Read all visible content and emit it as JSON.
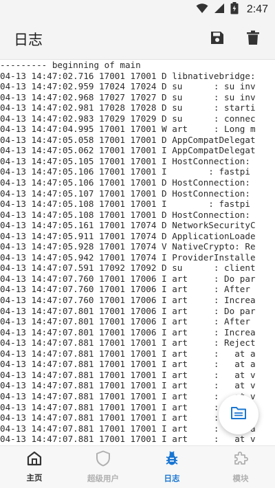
{
  "status_bar": {
    "time": "2:47",
    "icons": [
      "wifi-icon",
      "signal-icon",
      "battery-icon"
    ]
  },
  "app_bar": {
    "title": "日志",
    "actions": [
      "save-icon",
      "delete-icon"
    ]
  },
  "log": {
    "lines": [
      "--------- beginning of main",
      "04-13 14:47:02.716 17001 17001 D libnativebridge:",
      "04-13 14:47:02.959 17024 17024 D su      : su inv",
      "04-13 14:47:02.968 17027 17027 D su      : su inv",
      "04-13 14:47:02.981 17028 17028 D su      : starti",
      "04-13 14:47:02.983 17029 17029 D su      : connec",
      "04-13 14:47:04.995 17001 17001 W art     : Long m",
      "04-13 14:47:05.058 17001 17001 D AppCompatDelegat",
      "04-13 14:47:05.062 17001 17001 I AppCompatDelegat",
      "04-13 14:47:05.105 17001 17001 I HostConnection:",
      "04-13 14:47:05.106 17001 17001 I        : fastpi",
      "04-13 14:47:05.106 17001 17001 D HostConnection:",
      "04-13 14:47:05.107 17001 17001 D HostConnection:",
      "04-13 14:47:05.108 17001 17001 I        : fastpi",
      "04-13 14:47:05.108 17001 17001 D HostConnection:",
      "04-13 14:47:05.161 17001 17074 D NetworkSecurityC",
      "04-13 14:47:05.911 17001 17074 D ApplicationLoade",
      "04-13 14:47:05.928 17001 17074 V NativeCrypto: Re",
      "04-13 14:47:05.942 17001 17074 I ProviderInstalle",
      "04-13 14:47:07.591 17092 17092 D su      : client",
      "04-13 14:47:07.760 17001 17006 I art     : Do par",
      "04-13 14:47:07.760 17001 17006 I art     : After",
      "04-13 14:47:07.760 17001 17006 I art     : Increa",
      "04-13 14:47:07.801 17001 17006 I art     : Do par",
      "04-13 14:47:07.801 17001 17006 I art     : After",
      "04-13 14:47:07.801 17001 17006 I art     : Increa",
      "04-13 14:47:07.881 17001 17001 I art     : Reject",
      "04-13 14:47:07.881 17001 17001 I art     :   at a",
      "04-13 14:47:07.881 17001 17001 I art     :   at a",
      "04-13 14:47:07.881 17001 17001 I art     :   at v",
      "04-13 14:47:07.881 17001 17001 I art     :   at v",
      "04-13 14:47:07.881 17001 17001 I art     :   at v",
      "04-13 14:47:07.881 17001 17001 I art     :   at v",
      "04-13 14:47:07.881 17001 17001 I art     :   at v",
      "04-13 14:47:07.881 17001 17001 I art     :   at a",
      "04-13 14:47:07.881 17001 17001 I art     :   at v"
    ]
  },
  "fab": {
    "icon": "log-file-icon"
  },
  "bottom_nav": {
    "items": [
      {
        "label": "主页",
        "icon": "home-icon",
        "active": false
      },
      {
        "label": "超级用户",
        "icon": "shield-icon",
        "active": false
      },
      {
        "label": "日志",
        "icon": "bug-icon",
        "active": true
      },
      {
        "label": "模块",
        "icon": "puzzle-icon",
        "active": false
      }
    ],
    "colors": {
      "active": "#1976d2",
      "normal": "#333333",
      "disabled": "#b0b0b0"
    }
  }
}
